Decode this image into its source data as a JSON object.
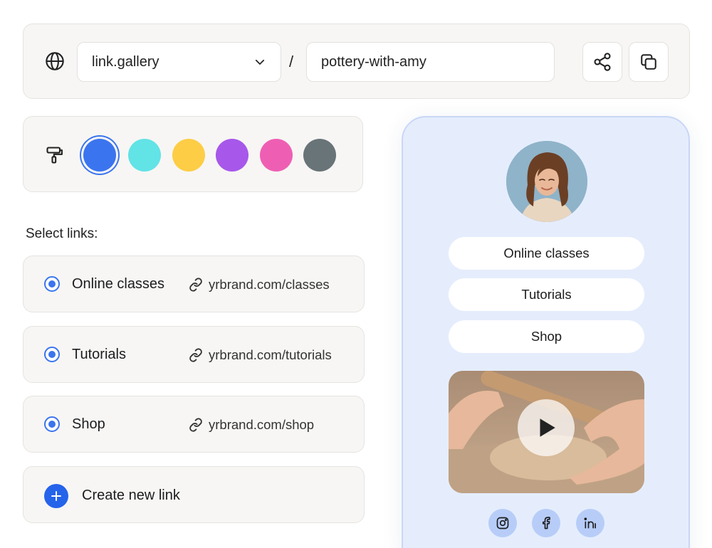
{
  "url_bar": {
    "domain": "link.gallery",
    "separator": "/",
    "slug": "pottery-with-amy",
    "icons": [
      "globe-icon",
      "chevron-down-icon",
      "share-icon",
      "copy-icon"
    ]
  },
  "palette": {
    "icon": "paint-roller-icon",
    "swatches": [
      "#3b74ef",
      "#62e3e6",
      "#fdcd46",
      "#a757ea",
      "#ee5fb3",
      "#687478"
    ],
    "selected": "#3b74ef"
  },
  "links_section": {
    "label": "Select links:",
    "items": [
      {
        "name": "Online classes",
        "url": "yrbrand.com/classes"
      },
      {
        "name": "Tutorials",
        "url": "yrbrand.com/tutorials"
      },
      {
        "name": "Shop",
        "url": "yrbrand.com/shop"
      }
    ],
    "create_label": "Create new link"
  },
  "preview": {
    "buttons": [
      "Online classes",
      "Tutorials",
      "Shop"
    ],
    "socials": [
      "instagram-icon",
      "facebook-icon",
      "linkedin-icon"
    ]
  },
  "colors": {
    "accent": "#3b74ef",
    "preview_bg": "#e5edfd",
    "card_bg": "#f7f6f4"
  }
}
